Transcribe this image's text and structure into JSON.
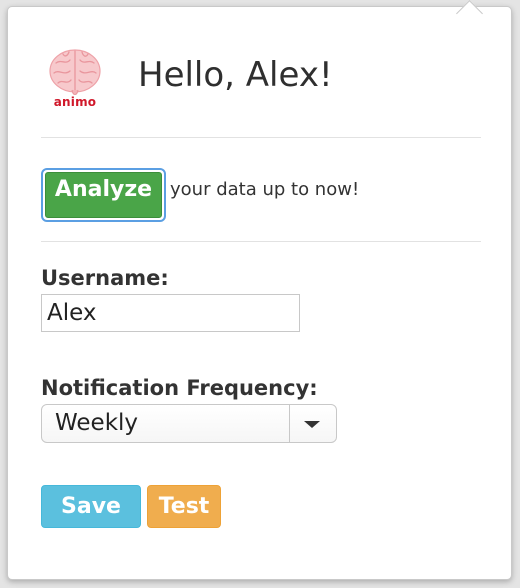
{
  "header": {
    "logo_text": "animo",
    "greeting": "Hello, Alex!"
  },
  "analyze": {
    "button_label": "Analyze",
    "description": "your data up to now!"
  },
  "form": {
    "username_label": "Username:",
    "username_value": "Alex",
    "frequency_label": "Notification Frequency:",
    "frequency_value": "Weekly"
  },
  "actions": {
    "save_label": "Save",
    "test_label": "Test"
  },
  "colors": {
    "analyze_green": "#4aa548",
    "save_blue": "#5bc0de",
    "test_orange": "#f0ad4e",
    "logo_red": "#d0182a"
  },
  "icons": {
    "logo": "brain-icon",
    "dropdown": "caret-down-icon"
  }
}
